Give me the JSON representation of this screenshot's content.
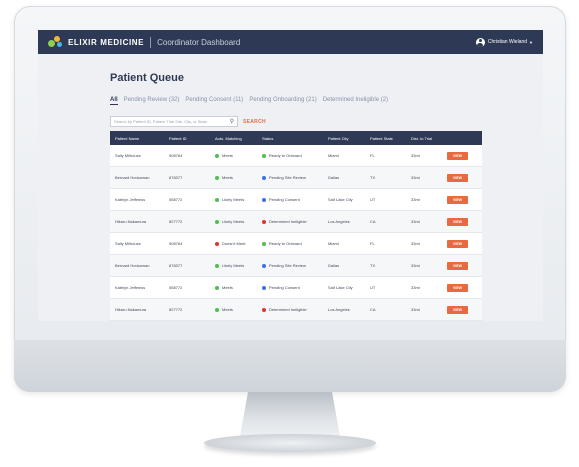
{
  "app": {
    "brand": "Elixir Medicine",
    "subtitle": "Coordinator Dashboard",
    "user_name": "Christian Wieland",
    "colors": {
      "navbar": "#2e3a55",
      "accent": "#e86b3f",
      "green": "#4fbf4f",
      "blue": "#3d6fe0",
      "red": "#e0342b"
    }
  },
  "page": {
    "title": "Patient Queue",
    "tabs": [
      {
        "label": "All"
      },
      {
        "label": "Pending Review (32)"
      },
      {
        "label": "Pending Consent (11)"
      },
      {
        "label": "Pending Onboarding (21)"
      },
      {
        "label": "Determined Ineligible (2)"
      }
    ],
    "search_placeholder": "Search by Patient ID, Patient Trial Site, City, or State",
    "search_button": "SEARCH"
  },
  "table": {
    "headers": [
      "Patient Name",
      "Patient ID",
      "Auto. Matching",
      "Status",
      "Patient City",
      "Patient State",
      "Dist. to Trial",
      ""
    ],
    "rows": [
      {
        "name": "Sally Milhouse",
        "id": "908764",
        "match": "Meets",
        "match_color": "#4fbf4f",
        "status": "Ready to Onboard",
        "status_color": "#4fbf4f",
        "city": "Miami",
        "state": "FL",
        "dist": "33mi",
        "action": "VIEW"
      },
      {
        "name": "Bernard Hodownan",
        "id": "878377",
        "match": "Meets",
        "match_color": "#4fbf4f",
        "status": "Pending Site Review",
        "status_color": "#3d6fe0",
        "city": "Dallas",
        "state": "TX",
        "dist": "33mi",
        "action": "VIEW"
      },
      {
        "name": "Katelyn Jeffeniss",
        "id": "558772",
        "match": "Likely Meets",
        "match_color": "#4fbf4f",
        "status": "Pending Consent",
        "status_color": "#3d6fe0",
        "city": "Salt Lake City",
        "state": "UT",
        "dist": "33mi",
        "action": "VIEW"
      },
      {
        "name": "Hikaru Nakamura",
        "id": "827772",
        "match": "Likely Meets",
        "match_color": "#4fbf4f",
        "status": "Determined Ineligible",
        "status_color": "#e0342b",
        "city": "Los Angeles",
        "state": "CA",
        "dist": "33mi",
        "action": "VIEW"
      },
      {
        "name": "Sally Milhouse",
        "id": "908764",
        "match": "Doesn't Meet",
        "match_color": "#e0342b",
        "status": "Ready to Onboard",
        "status_color": "#4fbf4f",
        "city": "Miami",
        "state": "FL",
        "dist": "33mi",
        "action": "VIEW"
      },
      {
        "name": "Bernard Hodownan",
        "id": "878377",
        "match": "Likely Meets",
        "match_color": "#4fbf4f",
        "status": "Pending Site Review",
        "status_color": "#3d6fe0",
        "city": "Dallas",
        "state": "TX",
        "dist": "33mi",
        "action": "VIEW"
      },
      {
        "name": "Katelyn Jeffeniss",
        "id": "558772",
        "match": "Meets",
        "match_color": "#4fbf4f",
        "status": "Pending Consent",
        "status_color": "#3d6fe0",
        "city": "Salt Lake City",
        "state": "UT",
        "dist": "33mi",
        "action": "VIEW"
      },
      {
        "name": "Hikaru Nakamura",
        "id": "827772",
        "match": "Meets",
        "match_color": "#4fbf4f",
        "status": "Determined Ineligible",
        "status_color": "#e0342b",
        "city": "Los Angeles",
        "state": "CA",
        "dist": "33mi",
        "action": "VIEW"
      }
    ]
  }
}
